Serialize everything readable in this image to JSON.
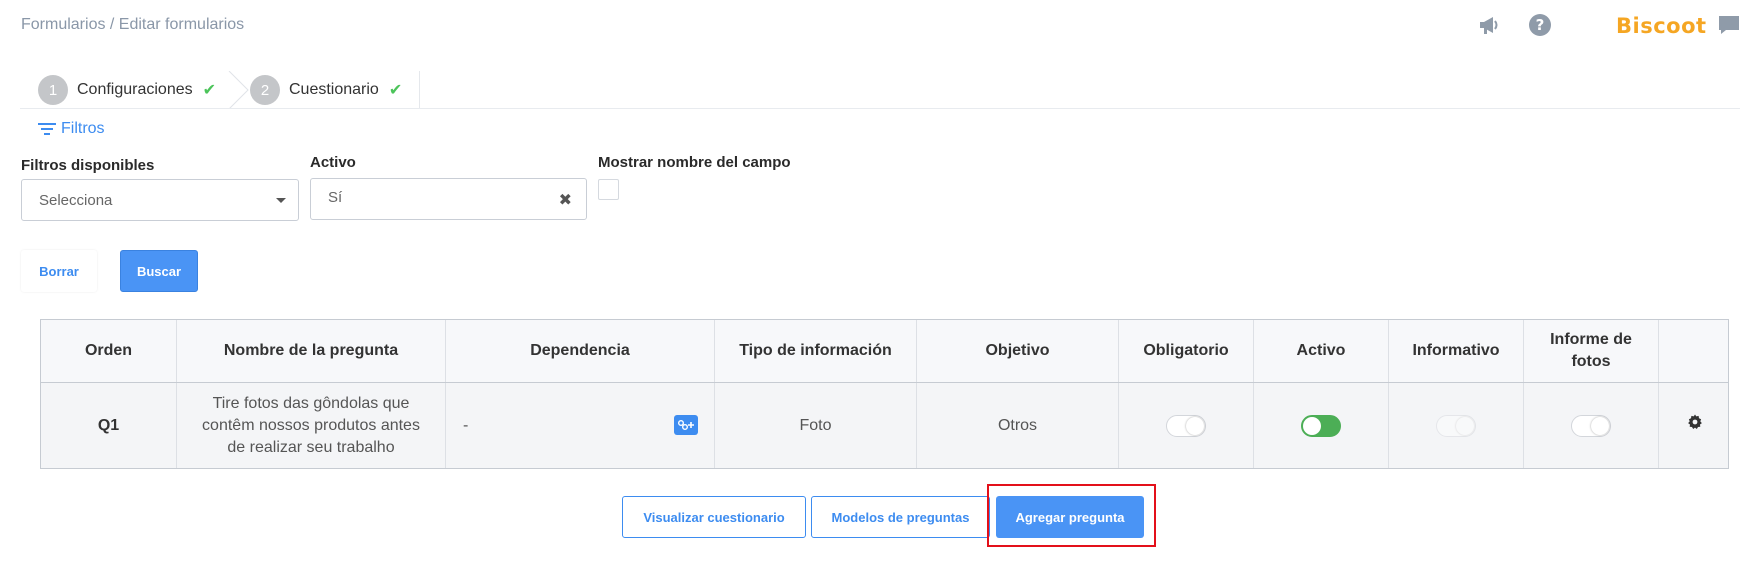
{
  "breadcrumb": "Formularios / Editar formularios",
  "header": {
    "brand": "Biscoot",
    "icons": [
      "megaphone-icon",
      "help-icon",
      "chat-icon"
    ]
  },
  "stepper": {
    "steps": [
      {
        "number": "1",
        "label": "Configuraciones",
        "done": true
      },
      {
        "number": "2",
        "label": "Cuestionario",
        "done": true
      }
    ]
  },
  "filters": {
    "toggle_label": "Filtros",
    "available": {
      "label": "Filtros disponibles",
      "value": "Selecciona"
    },
    "activo": {
      "label": "Activo",
      "value": "Sí"
    },
    "show_field_name": {
      "label": "Mostrar nombre del campo",
      "checked": false
    },
    "clear_label": "Borrar",
    "search_label": "Buscar"
  },
  "table": {
    "headers": {
      "orden": "Orden",
      "nombre": "Nombre de la pregunta",
      "dependencia": "Dependencia",
      "tipo": "Tipo de información",
      "objetivo": "Objetivo",
      "obligatorio": "Obligatorio",
      "activo": "Activo",
      "informativo": "Informativo",
      "informe1": "Informe de",
      "informe2": "fotos"
    },
    "rows": [
      {
        "orden": "Q1",
        "nombre1": "Tire fotos das gôndolas que",
        "nombre2": "contêm nossos produtos antes",
        "nombre3": "de realizar seu trabalho",
        "dependencia": "-",
        "tipo": "Foto",
        "objetivo": "Otros",
        "obligatorio": false,
        "activo": true,
        "informativo": false,
        "informe_fotos": false
      }
    ]
  },
  "actions": {
    "preview": "Visualizar cuestionario",
    "models": "Modelos de preguntas",
    "add": "Agregar pregunta"
  },
  "colors": {
    "accent": "#4a94f5",
    "brand": "#f5a623",
    "success": "#4cae56",
    "highlight": "#e3101a"
  }
}
